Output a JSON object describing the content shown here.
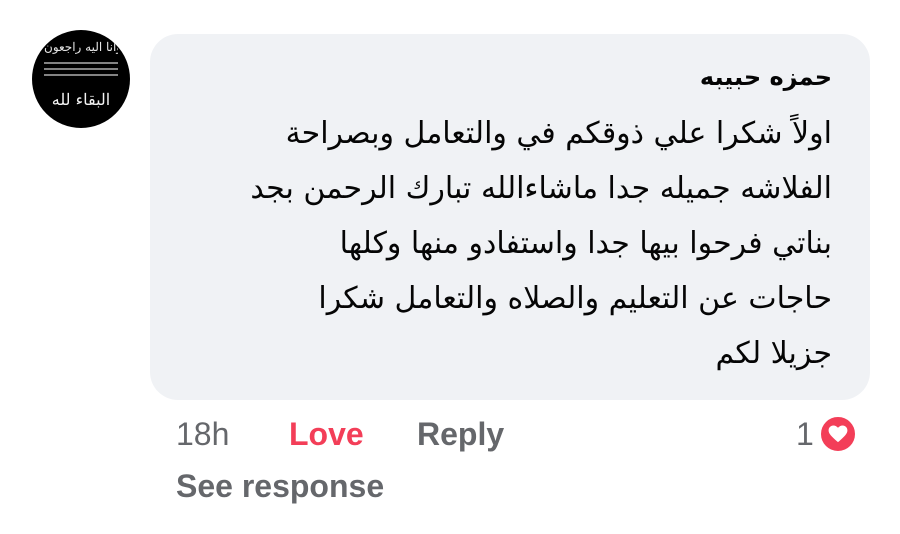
{
  "avatar": {
    "top_text": "انا لله وانا اليه راجعون",
    "bottom_text": "البقاء لله"
  },
  "comment": {
    "author": "حمزه حبيبه",
    "lines": [
      "اولاً شكرا علي ذوقكم في والتعامل وبصراحة",
      "الفلاشه جميله جدا ماشاءالله تبارك الرحمن بجد",
      "بناتي فرحوا بيها جدا واستفادو منها وكلها",
      "حاجات عن التعليم والصلاه والتعامل شكرا",
      "جزيلا لكم"
    ],
    "bubble_color": "#f0f2f5"
  },
  "actions": {
    "time": "18h",
    "love_label": "Love",
    "love_color": "#f33e58",
    "reply_label": "Reply",
    "reaction_count": "1",
    "reaction_icon": "heart-icon",
    "see_response_label": "See response"
  }
}
